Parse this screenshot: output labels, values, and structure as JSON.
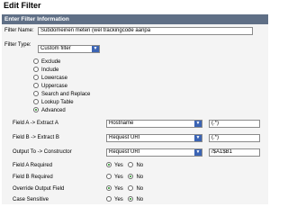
{
  "page": {
    "title": "Edit Filter"
  },
  "section": {
    "header": "Enter Filter Information"
  },
  "filter_name": {
    "label": "Filter Name:",
    "value": "Subdomeinen meten (wel trackingcode aanpa"
  },
  "filter_type": {
    "label": "Filter Type:",
    "selected": "Custom filter",
    "options": [
      "Exclude",
      "Include",
      "Lowercase",
      "Uppercase",
      "Search and Replace",
      "Lookup Table",
      "Advanced"
    ],
    "selected_option": "Advanced"
  },
  "advanced": {
    "field_a": {
      "label": "Field A -> Extract A",
      "select": "Hostname",
      "value": "(.*)"
    },
    "field_b": {
      "label": "Field B -> Extract B",
      "select": "Request URI",
      "value": "(.*)"
    },
    "output": {
      "label": "Output To -> Constructor",
      "select": "Request URI",
      "value": "/$A1$B1"
    }
  },
  "toggles": {
    "yes_label": "Yes",
    "no_label": "No",
    "field_a_required": {
      "label": "Field A Required",
      "value": "Yes"
    },
    "field_b_required": {
      "label": "Field B Required",
      "value": "No"
    },
    "override_output": {
      "label": "Override Output Field",
      "value": "Yes"
    },
    "case_sensitive": {
      "label": "Case Sensitive",
      "value": "No"
    }
  },
  "colors": {
    "header_bar": "#5f6f86",
    "radio_selected": "#1f8a1f",
    "select_arrow": "#3b64b4"
  }
}
